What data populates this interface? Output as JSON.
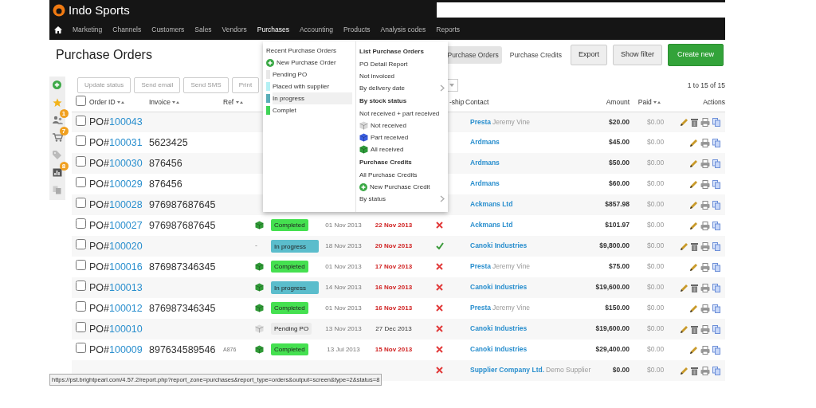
{
  "app": {
    "name": "Indo Sports"
  },
  "nav": [
    {
      "label": "Marketing",
      "selected": false
    },
    {
      "label": "Channels",
      "selected": false
    },
    {
      "label": "Customers",
      "selected": false
    },
    {
      "label": "Sales",
      "selected": false
    },
    {
      "label": "Vendors",
      "selected": false
    },
    {
      "label": "Purchases",
      "selected": true
    },
    {
      "label": "Accounting",
      "selected": false
    },
    {
      "label": "Products",
      "selected": false
    },
    {
      "label": "Analysis codes",
      "selected": false
    },
    {
      "label": "Reports",
      "selected": false
    }
  ],
  "page_title": "Purchase Orders",
  "view_tabs": [
    {
      "label": "Purchase Orders",
      "selected": true
    },
    {
      "label": "Purchase Credits",
      "selected": false
    }
  ],
  "header_buttons": [
    {
      "label": "Export",
      "kind": "plain"
    },
    {
      "label": "Show filter",
      "kind": "plain"
    },
    {
      "label": "Create new",
      "kind": "primary"
    }
  ],
  "sidebar": [
    {
      "kind": "add"
    },
    {
      "kind": "star"
    },
    {
      "kind": "people",
      "badge": "1"
    },
    {
      "kind": "cart",
      "badge": "7"
    },
    {
      "kind": "tag"
    },
    {
      "kind": "chart",
      "badge": "8"
    },
    {
      "kind": "copy"
    }
  ],
  "toolbar": [
    "Update status",
    "Send email",
    "Send SMS",
    "Print"
  ],
  "pager": "1 to 15 of 15",
  "columns": [
    {
      "label": "Order ID",
      "sortable": true
    },
    {
      "label": "Invoice",
      "sortable": true
    },
    {
      "label": "Ref",
      "sortable": true
    },
    {
      "label": "-ship",
      "sortable": false
    },
    {
      "label": "Contact",
      "sortable": false
    },
    {
      "label": "Amount",
      "sortable": false
    },
    {
      "label": "Paid",
      "sortable": true
    },
    {
      "label": "Actions",
      "sortable": false
    }
  ],
  "all_checked": false,
  "rows": [
    {
      "checked": false,
      "prefix": "PO#",
      "number": "100043",
      "company": "Presta",
      "person": "Jeremy Vine",
      "amount": "$20.00",
      "paid": "$0.00",
      "deletable": true
    },
    {
      "checked": false,
      "prefix": "PO#",
      "number": "100031",
      "invoice": "5623425",
      "company": "Ardmans",
      "amount": "$45.00",
      "paid": "$0.00",
      "deletable": false
    },
    {
      "checked": false,
      "prefix": "PO#",
      "number": "100030",
      "invoice": "876456",
      "company": "Ardmans",
      "amount": "$50.00",
      "paid": "$0.00",
      "deletable": false
    },
    {
      "checked": false,
      "prefix": "PO#",
      "number": "100029",
      "invoice": "876456",
      "company": "Ardmans",
      "amount": "$60.00",
      "paid": "$0.00",
      "deletable": false
    },
    {
      "checked": false,
      "prefix": "PO#",
      "number": "100028",
      "invoice": "976987687645",
      "company": "Ackmans Ltd",
      "amount": "$857.98",
      "paid": "$0.00",
      "deletable": false
    },
    {
      "checked": false,
      "prefix": "PO#",
      "number": "100027",
      "invoice": "976987687645",
      "stock": {
        "kind": "all"
      },
      "status": {
        "label": "Completed",
        "kind": "completed"
      },
      "date": "01 Nov 2013",
      "due": "22 Nov 2013",
      "overdue": true,
      "dropship": {
        "kind": "cross"
      },
      "company": "Ackmans Ltd",
      "amount": "$101.97",
      "paid": "$0.00",
      "deletable": false
    },
    {
      "checked": false,
      "prefix": "PO#",
      "number": "100020",
      "stock_text": "-",
      "status": {
        "label": "In progress",
        "kind": "progress"
      },
      "date": "18 Nov 2013",
      "due": "20 Nov 2013",
      "overdue": true,
      "dropship": {
        "kind": "check"
      },
      "company": "Canoki Industries",
      "amount": "$9,800.00",
      "paid": "$0.00",
      "deletable": true
    },
    {
      "checked": false,
      "prefix": "PO#",
      "number": "100016",
      "invoice": "876987346345",
      "stock": {
        "kind": "all"
      },
      "status": {
        "label": "Completed",
        "kind": "completed"
      },
      "date": "01 Nov 2013",
      "due": "17 Nov 2013",
      "overdue": true,
      "dropship": {
        "kind": "cross"
      },
      "company": "Presta",
      "person": "Jeremy Vine",
      "amount": "$75.00",
      "paid": "$0.00",
      "deletable": false
    },
    {
      "checked": false,
      "prefix": "PO#",
      "number": "100013",
      "stock": {
        "kind": "all"
      },
      "status": {
        "label": "In progress",
        "kind": "progress"
      },
      "date": "14 Nov 2013",
      "due": "16 Nov 2013",
      "overdue": true,
      "dropship": {
        "kind": "cross"
      },
      "company": "Canoki Industries",
      "amount": "$19,600.00",
      "paid": "$0.00",
      "deletable": true
    },
    {
      "checked": false,
      "prefix": "PO#",
      "number": "100012",
      "invoice": "876987346345",
      "stock": {
        "kind": "all"
      },
      "status": {
        "label": "Completed",
        "kind": "completed"
      },
      "date": "01 Nov 2013",
      "due": "16 Nov 2013",
      "overdue": true,
      "dropship": {
        "kind": "cross"
      },
      "company": "Presta",
      "person": "Jeremy Vine",
      "amount": "$150.00",
      "paid": "$0.00",
      "deletable": false
    },
    {
      "checked": false,
      "prefix": "PO#",
      "number": "100010",
      "stock": {
        "kind": "none"
      },
      "status": {
        "label": "Pending PO",
        "kind": "pending"
      },
      "date": "13 Nov 2013",
      "due": "27 Dec 2013",
      "overdue": false,
      "dropship": {
        "kind": "cross"
      },
      "company": "Canoki Industries",
      "amount": "$19,600.00",
      "paid": "$0.00",
      "deletable": true
    },
    {
      "checked": false,
      "prefix": "PO#",
      "number": "100009",
      "invoice": "897634589546",
      "ref": "A876",
      "stock": {
        "kind": "all"
      },
      "status": {
        "label": "Completed",
        "kind": "completed"
      },
      "date": "13 Jul 2013",
      "due": "15 Nov 2013",
      "overdue": true,
      "dropship": {
        "kind": "cross"
      },
      "company": "Canoki Industries",
      "amount": "$29,400.00",
      "paid": "$0.00",
      "deletable": false
    },
    {
      "dropship": {
        "kind": "cross"
      },
      "company": "Supplier Company Ltd.",
      "person": "Demo Supplier",
      "amount": "$0.00",
      "paid": "$0.00",
      "deletable": true
    }
  ],
  "menu": {
    "left": [
      {
        "kind": "caption",
        "label": "Recent Purchase Orders"
      },
      {
        "kind": "new",
        "label": "New Purchase Order"
      },
      {
        "kind": "status",
        "label": "Pending PO",
        "color": "#e8e8e8",
        "hovered": false
      },
      {
        "kind": "status",
        "label": "Placed with supplier",
        "color": "#b4f0f4",
        "hovered": false
      },
      {
        "kind": "status",
        "label": "In progress",
        "color": "#5aaeb8",
        "hovered": true
      },
      {
        "kind": "status",
        "label": "Complet",
        "color": "#3fd457",
        "hovered": false
      }
    ],
    "right": [
      {
        "kind": "heading",
        "label": "List Purchase Orders"
      },
      {
        "kind": "item",
        "label": "PO Detail Report"
      },
      {
        "kind": "item",
        "label": "Not invoiced"
      },
      {
        "kind": "submenu",
        "label": "By delivery date"
      },
      {
        "kind": "heading",
        "label": "By stock status"
      },
      {
        "kind": "item",
        "label": "Not received + part received"
      },
      {
        "kind": "cube",
        "label": "Not received",
        "color": "#d8d8d8"
      },
      {
        "kind": "cube",
        "label": "Part received",
        "color": "#3a5de0"
      },
      {
        "kind": "cube",
        "label": "All received",
        "color": "#2e9a3a"
      },
      {
        "kind": "heading",
        "label": "Purchase Credits"
      },
      {
        "kind": "item",
        "label": "All Purchase Credits"
      },
      {
        "kind": "new",
        "label": "New Purchase Credit"
      },
      {
        "kind": "submenu",
        "label": "By status"
      }
    ]
  },
  "status_url": "https://pst.brightpearl.com/4.57.2/report.php?report_zone=purchases&report_type=orders&output=screen&type=2&status=8"
}
